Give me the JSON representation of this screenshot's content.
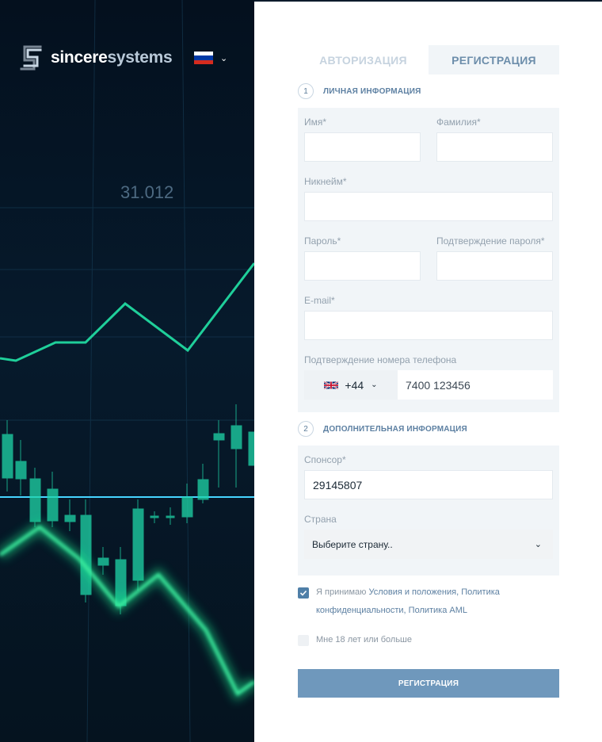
{
  "brand": {
    "name_part1": "sincere",
    "name_part2": "systems"
  },
  "background": {
    "price_label": "31.012"
  },
  "language": {
    "flag": "ru-flag-icon",
    "chevron": "chevron-down-icon"
  },
  "tabs": [
    {
      "label": "АВТОРИЗАЦИЯ",
      "active": false
    },
    {
      "label": "РЕГИСТРАЦИЯ",
      "active": true
    }
  ],
  "section1": {
    "number": "1",
    "title": "ЛИЧНАЯ ИНФОРМАЦИЯ",
    "first_name_label": "Имя*",
    "first_name_value": "",
    "last_name_label": "Фамилия*",
    "last_name_value": "",
    "nickname_label": "Никнейм*",
    "nickname_value": "",
    "password_label": "Пароль*",
    "password_value": "",
    "password_confirm_label": "Подтверждение пароля*",
    "password_confirm_value": "",
    "email_label": "E-mail*",
    "email_value": "",
    "phone_label": "Подтверждение номера телефона",
    "phone_code": "+44",
    "phone_number": "7400 123456"
  },
  "section2": {
    "number": "2",
    "title": "ДОПОЛНИТЕЛЬНАЯ ИНФОРМАЦИЯ",
    "sponsor_label": "Спонсор*",
    "sponsor_value": "29145807",
    "country_label": "Страна",
    "country_value": "Выберите страну.."
  },
  "terms": {
    "prefix": "Я принимаю ",
    "link1": "Условия и положения",
    "sep1": ", ",
    "link2": "Политика конфиденциальности",
    "sep2": ", ",
    "link3": "Политика AML",
    "checked": true
  },
  "age": {
    "label": "Мне 18 лет или больше",
    "checked": false
  },
  "submit_label": "РЕГИСТРАЦИЯ",
  "colors": {
    "accent": "#6f98bc",
    "panel": "#f1f5f8",
    "dark_bg": "#04101e",
    "chart_green": "#19e08a"
  }
}
